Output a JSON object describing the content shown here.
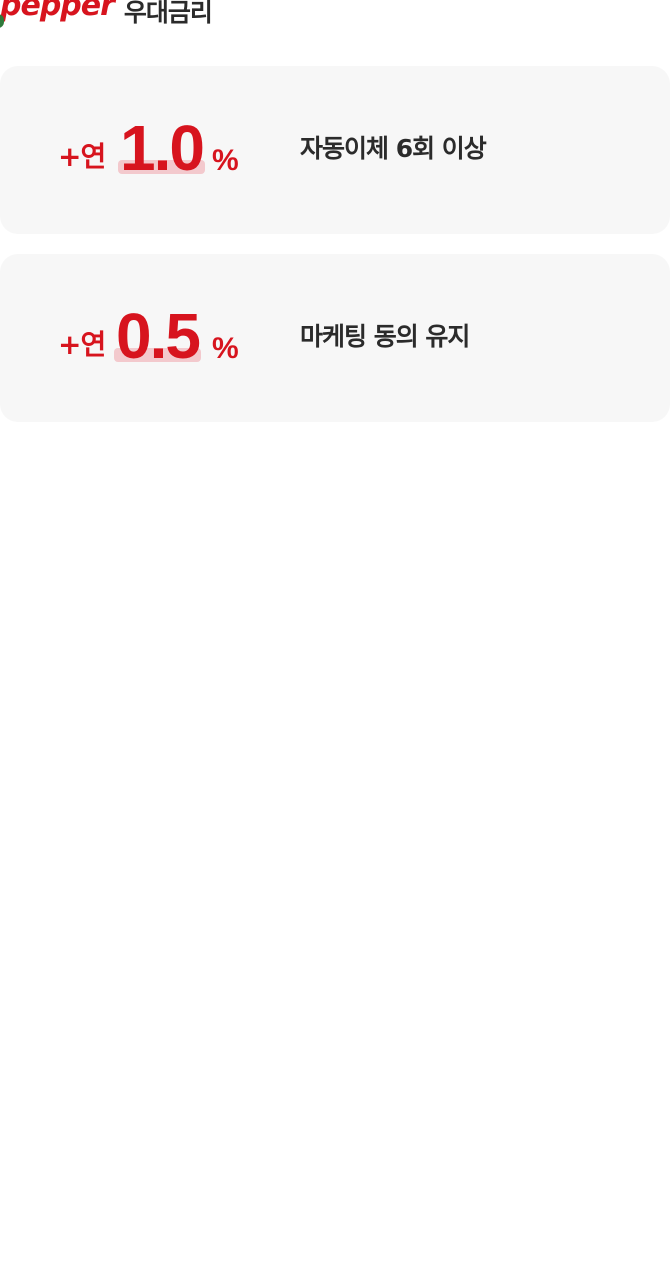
{
  "header": {
    "logo_text": "pepper",
    "title": "우대금리"
  },
  "benefits": [
    {
      "prefix": "+연",
      "rate": "1.0",
      "unit": "%",
      "condition": "자동이체 6회 이상"
    },
    {
      "prefix": "+연",
      "rate": "0.5",
      "unit": "%",
      "condition": "마케팅 동의 유지"
    }
  ],
  "colors": {
    "brand_red": "#d7141e",
    "leaf_green": "#2f7a3b",
    "card_bg": "#f7f7f7",
    "highlight": "#f3c9cd",
    "text_dark": "#2b2b2b"
  }
}
